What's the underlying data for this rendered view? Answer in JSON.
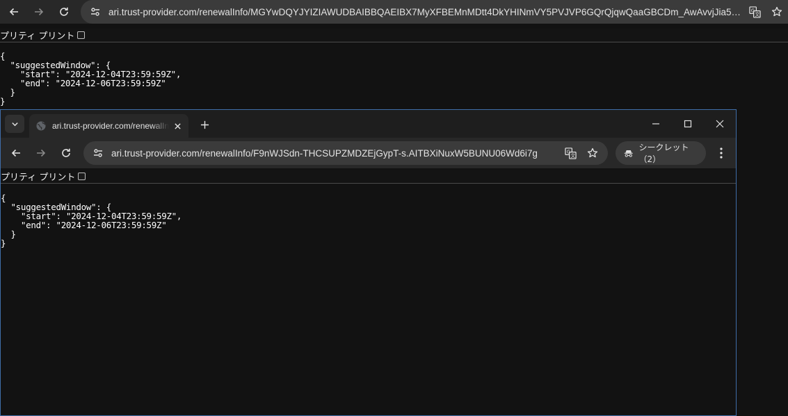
{
  "window1": {
    "url": "ari.trust-provider.com/renewalInfo/MGYwDQYJYIZIAWUDBAIBBQAEIBX7MyXFBEMnMDtt4DkYHINmVY5PVJVP6GQrQjqwQaaGBCDm_AwAvvjJia5G...",
    "pretty_print_label": "プリティ プリント",
    "json_text": "{\n  \"suggestedWindow\": {\n    \"start\": \"2024-12-04T23:59:59Z\",\n    \"end\": \"2024-12-06T23:59:59Z\"\n  }\n}"
  },
  "window2": {
    "tab_title": "ari.trust-provider.com/renewalInfo",
    "url": "ari.trust-provider.com/renewalInfo/F9nWJSdn-THCSUPZMDZEjGypT-s.AITBXiNuxW5BUNU06Wd6i7g",
    "incognito_label": "シークレット（2）",
    "pretty_print_label": "プリティ プリント",
    "json_text": "{\n  \"suggestedWindow\": {\n    \"start\": \"2024-12-04T23:59:59Z\",\n    \"end\": \"2024-12-06T23:59:59Z\"\n  }\n}"
  },
  "icons": {
    "back": "arrow-left-icon",
    "forward": "arrow-right-icon",
    "reload": "reload-icon",
    "site_info": "tune-icon",
    "translate": "translate-icon",
    "bookmark": "star-icon",
    "tab_search": "chevron-down-icon",
    "new_tab": "plus-icon",
    "incognito": "incognito-icon",
    "menu": "kebab-menu-icon"
  },
  "colors": {
    "background": "#121212",
    "toolbar": "#282828",
    "omnibox": "#3b3b3b",
    "window_border": "#3f6da8"
  }
}
